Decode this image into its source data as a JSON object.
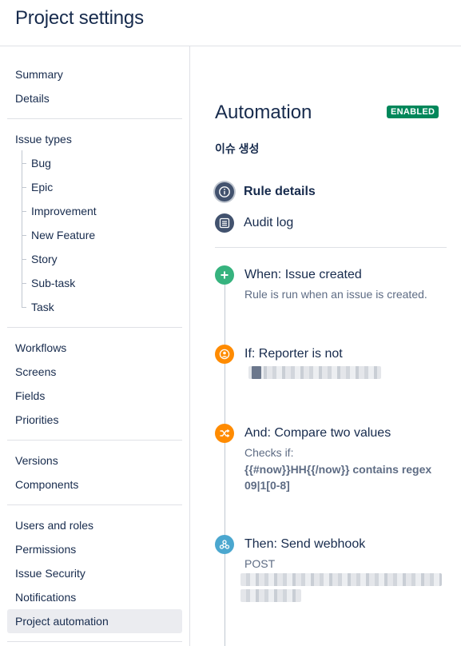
{
  "header": {
    "title": "Project settings"
  },
  "sidebar": {
    "items": [
      {
        "label": "Summary"
      },
      {
        "label": "Details"
      },
      {
        "label": "Issue types"
      },
      {
        "label": "Bug"
      },
      {
        "label": "Epic"
      },
      {
        "label": "Improvement"
      },
      {
        "label": "New Feature"
      },
      {
        "label": "Story"
      },
      {
        "label": "Sub-task"
      },
      {
        "label": "Task"
      },
      {
        "label": "Workflows"
      },
      {
        "label": "Screens"
      },
      {
        "label": "Fields"
      },
      {
        "label": "Priorities"
      },
      {
        "label": "Versions"
      },
      {
        "label": "Components"
      },
      {
        "label": "Users and roles"
      },
      {
        "label": "Permissions"
      },
      {
        "label": "Issue Security"
      },
      {
        "label": "Notifications"
      },
      {
        "label": "Project automation"
      }
    ],
    "active": "Project automation"
  },
  "main": {
    "title": "Automation",
    "status_badge": "ENABLED",
    "rule_name": "이슈 생성",
    "tabs": [
      {
        "label": "Rule details",
        "icon": "info-icon"
      },
      {
        "label": "Audit log",
        "icon": "list-icon"
      }
    ],
    "steps": [
      {
        "title": "When: Issue created",
        "description": "Rule is run when an issue is created.",
        "icon": "plus-icon",
        "color": "#36b37e"
      },
      {
        "title": "If: Reporter is not",
        "icon": "user-icon",
        "color": "#ff8b00"
      },
      {
        "title": "And: Compare two values",
        "description": "Checks if:",
        "condition": "{{#now}}HH{{/now}} contains regex 09|1[0-8]",
        "icon": "shuffle-icon",
        "color": "#ff8b00"
      },
      {
        "title": "Then: Send webhook",
        "description": "POST",
        "icon": "webhook-icon",
        "color": "#4ba7cf"
      }
    ]
  },
  "colors": {
    "primary_text": "#172b4d",
    "secondary_text": "#5e6c84",
    "success": "#00875a",
    "trigger": "#36b37e",
    "condition": "#ff8b00",
    "action": "#4ba7cf"
  }
}
